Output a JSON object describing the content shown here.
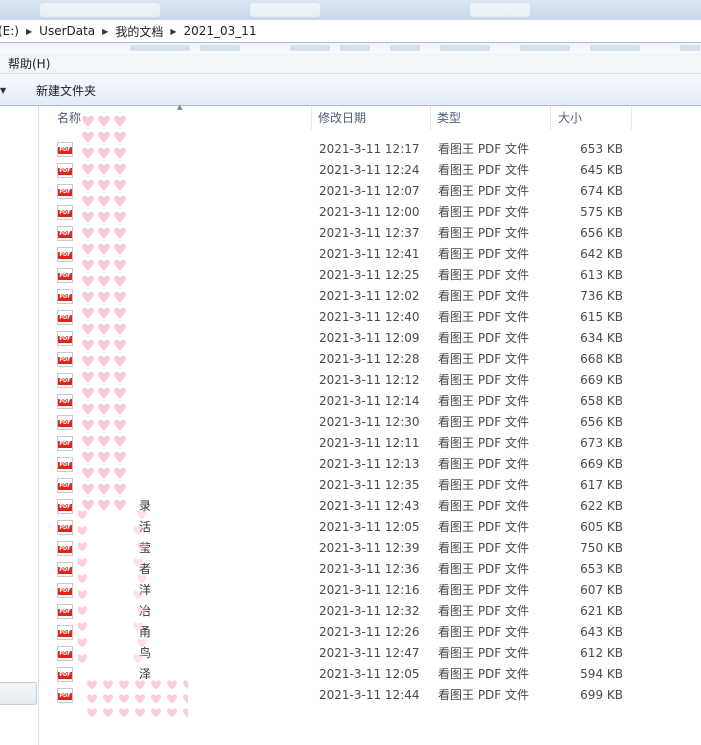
{
  "window": {
    "address": {
      "crumbs": [
        "(E:)",
        "UserData",
        "我的文档",
        "2021_03_11"
      ]
    }
  },
  "menu": {
    "items": [
      "帮助(H)"
    ]
  },
  "toolbar": {
    "new_folder": "新建文件夹"
  },
  "columns": {
    "name": "名称",
    "date": "修改日期",
    "type": "类型",
    "size": "大小"
  },
  "icons": {
    "file_icon": "pdf-file-icon",
    "file_icon_label": "PDF"
  },
  "colors": {
    "pdf_red": "#e2231a",
    "header_text": "#4c607a",
    "privacy_mask": "#f7c2cc"
  },
  "files": [
    {
      "name": "",
      "date": "2021-3-11 12:17",
      "type": "看图王 PDF 文件",
      "size": "653 KB"
    },
    {
      "name": "",
      "date": "2021-3-11 12:24",
      "type": "看图王 PDF 文件",
      "size": "645 KB"
    },
    {
      "name": "",
      "date": "2021-3-11 12:07",
      "type": "看图王 PDF 文件",
      "size": "674 KB"
    },
    {
      "name": "",
      "date": "2021-3-11 12:00",
      "type": "看图王 PDF 文件",
      "size": "575 KB"
    },
    {
      "name": "",
      "date": "2021-3-11 12:37",
      "type": "看图王 PDF 文件",
      "size": "656 KB"
    },
    {
      "name": "",
      "date": "2021-3-11 12:41",
      "type": "看图王 PDF 文件",
      "size": "642 KB"
    },
    {
      "name": "",
      "date": "2021-3-11 12:25",
      "type": "看图王 PDF 文件",
      "size": "613 KB"
    },
    {
      "name": "",
      "date": "2021-3-11 12:02",
      "type": "看图王 PDF 文件",
      "size": "736 KB"
    },
    {
      "name": "",
      "date": "2021-3-11 12:40",
      "type": "看图王 PDF 文件",
      "size": "615 KB"
    },
    {
      "name": "",
      "date": "2021-3-11 12:09",
      "type": "看图王 PDF 文件",
      "size": "634 KB"
    },
    {
      "name": "",
      "date": "2021-3-11 12:28",
      "type": "看图王 PDF 文件",
      "size": "668 KB"
    },
    {
      "name": "",
      "date": "2021-3-11 12:12",
      "type": "看图王 PDF 文件",
      "size": "669 KB"
    },
    {
      "name": "",
      "date": "2021-3-11 12:14",
      "type": "看图王 PDF 文件",
      "size": "658 KB"
    },
    {
      "name": "",
      "date": "2021-3-11 12:30",
      "type": "看图王 PDF 文件",
      "size": "656 KB"
    },
    {
      "name": "",
      "date": "2021-3-11 12:11",
      "type": "看图王 PDF 文件",
      "size": "673 KB"
    },
    {
      "name": "",
      "date": "2021-3-11 12:13",
      "type": "看图王 PDF 文件",
      "size": "669 KB"
    },
    {
      "name": "",
      "date": "2021-3-11 12:35",
      "type": "看图王 PDF 文件",
      "size": "617 KB"
    },
    {
      "name": "录",
      "date": "2021-3-11 12:43",
      "type": "看图王 PDF 文件",
      "size": "622 KB"
    },
    {
      "name": "活",
      "date": "2021-3-11 12:05",
      "type": "看图王 PDF 文件",
      "size": "605 KB"
    },
    {
      "name": "莹",
      "date": "2021-3-11 12:39",
      "type": "看图王 PDF 文件",
      "size": "750 KB"
    },
    {
      "name": "者",
      "date": "2021-3-11 12:36",
      "type": "看图王 PDF 文件",
      "size": "653 KB"
    },
    {
      "name": "洋",
      "date": "2021-3-11 12:16",
      "type": "看图王 PDF 文件",
      "size": "607 KB"
    },
    {
      "name": "冶",
      "date": "2021-3-11 12:32",
      "type": "看图王 PDF 文件",
      "size": "621 KB"
    },
    {
      "name": "甬",
      "date": "2021-3-11 12:26",
      "type": "看图王 PDF 文件",
      "size": "643 KB"
    },
    {
      "name": "鸟",
      "date": "2021-3-11 12:47",
      "type": "看图王 PDF 文件",
      "size": "612 KB"
    },
    {
      "name": "泽",
      "date": "2021-3-11 12:05",
      "type": "看图王 PDF 文件",
      "size": "594 KB"
    },
    {
      "name": "",
      "date": "2021-3-11 12:44",
      "type": "看图王 PDF 文件",
      "size": "699 KB"
    }
  ]
}
